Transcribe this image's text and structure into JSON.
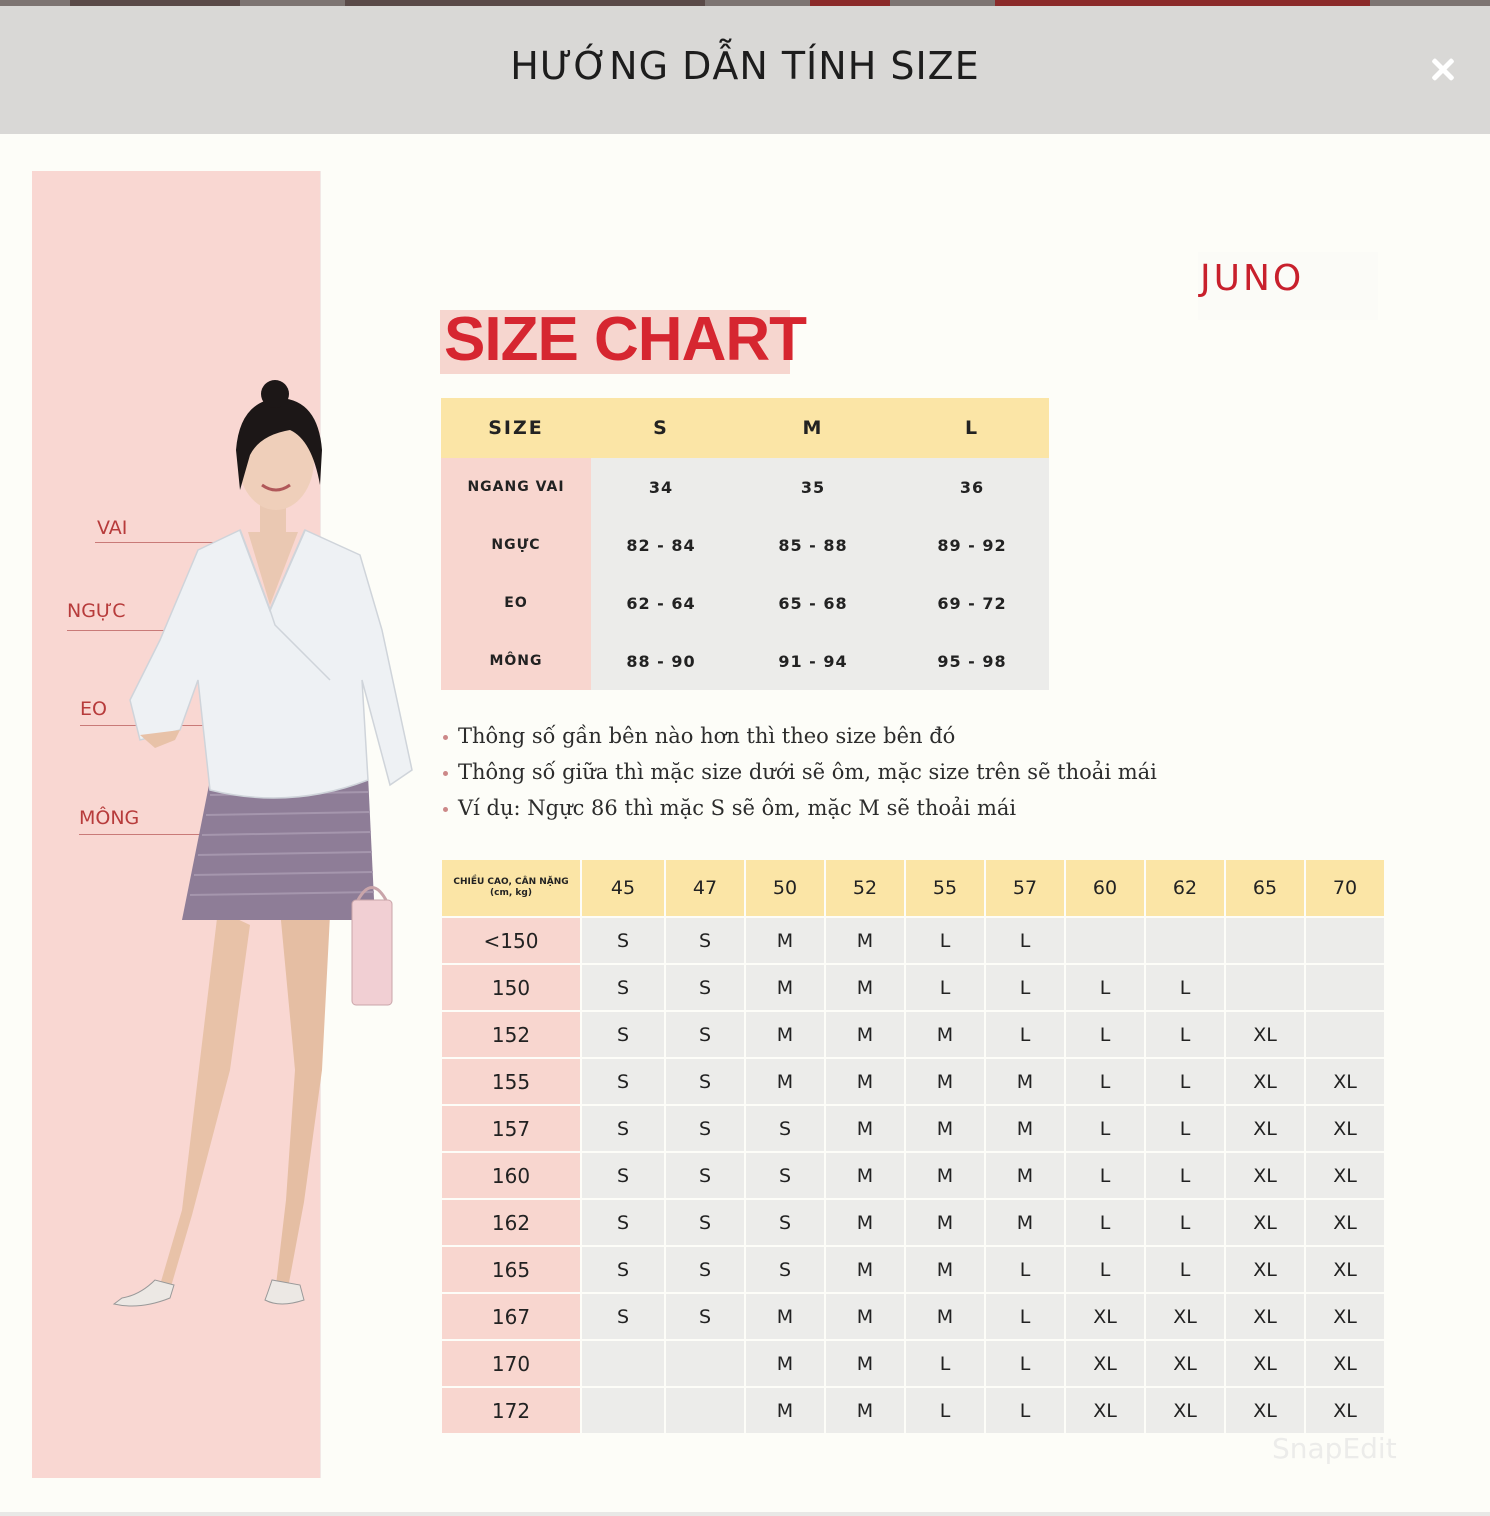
{
  "modal": {
    "title": "HƯỚNG DẪN TÍNH SIZE",
    "close_icon": "close-icon"
  },
  "body_labels": {
    "shoulder": "VAI",
    "chest": "NGỰC",
    "waist": "EO",
    "hip": "MÔNG"
  },
  "brand": {
    "logo": "JUNO",
    "title": "SIZE CHART",
    "accent_color": "#d62630"
  },
  "size_table": {
    "headers": [
      "SIZE",
      "S",
      "M",
      "L"
    ],
    "rows": [
      {
        "label": "NGANG VAI",
        "values": [
          "34",
          "35",
          "36"
        ]
      },
      {
        "label": "NGỰC",
        "values": [
          "82 - 84",
          "85 - 88",
          "89 - 92"
        ]
      },
      {
        "label": "EO",
        "values": [
          "62 - 64",
          "65 - 68",
          "69 - 72"
        ]
      },
      {
        "label": "MÔNG",
        "values": [
          "88 - 90",
          "91 - 94",
          "95 - 98"
        ]
      }
    ]
  },
  "notes": [
    "Thông số gần bên nào hơn thì theo size bên đó",
    "Thông số giữa thì mặc size dưới sẽ ôm, mặc size trên sẽ thoải mái",
    "Ví dụ: Ngực 86 thì mặc S sẽ ôm, mặc M sẽ thoải mái"
  ],
  "height_weight_table": {
    "corner_line1": "CHIỀU CAO, CÂN NẶNG",
    "corner_line2": "(cm, kg)",
    "weights": [
      "45",
      "47",
      "50",
      "52",
      "55",
      "57",
      "60",
      "62",
      "65",
      "70"
    ],
    "rows": [
      {
        "height": "<150",
        "sizes": [
          "S",
          "S",
          "M",
          "M",
          "L",
          "L",
          "",
          "",
          "",
          ""
        ]
      },
      {
        "height": "150",
        "sizes": [
          "S",
          "S",
          "M",
          "M",
          "L",
          "L",
          "L",
          "L",
          "",
          ""
        ]
      },
      {
        "height": "152",
        "sizes": [
          "S",
          "S",
          "M",
          "M",
          "M",
          "L",
          "L",
          "L",
          "XL",
          ""
        ]
      },
      {
        "height": "155",
        "sizes": [
          "S",
          "S",
          "M",
          "M",
          "M",
          "M",
          "L",
          "L",
          "XL",
          "XL"
        ]
      },
      {
        "height": "157",
        "sizes": [
          "S",
          "S",
          "S",
          "M",
          "M",
          "M",
          "L",
          "L",
          "XL",
          "XL"
        ]
      },
      {
        "height": "160",
        "sizes": [
          "S",
          "S",
          "S",
          "M",
          "M",
          "M",
          "L",
          "L",
          "XL",
          "XL"
        ]
      },
      {
        "height": "162",
        "sizes": [
          "S",
          "S",
          "S",
          "M",
          "M",
          "M",
          "L",
          "L",
          "XL",
          "XL"
        ]
      },
      {
        "height": "165",
        "sizes": [
          "S",
          "S",
          "S",
          "M",
          "M",
          "L",
          "L",
          "L",
          "XL",
          "XL"
        ]
      },
      {
        "height": "167",
        "sizes": [
          "S",
          "S",
          "M",
          "M",
          "M",
          "L",
          "XL",
          "XL",
          "XL",
          "XL"
        ]
      },
      {
        "height": "170",
        "sizes": [
          "",
          "",
          "M",
          "M",
          "L",
          "L",
          "XL",
          "XL",
          "XL",
          "XL"
        ]
      },
      {
        "height": "172",
        "sizes": [
          "",
          "",
          "M",
          "M",
          "L",
          "L",
          "XL",
          "XL",
          "XL",
          "XL"
        ]
      }
    ]
  },
  "watermark": "SnapEdit"
}
